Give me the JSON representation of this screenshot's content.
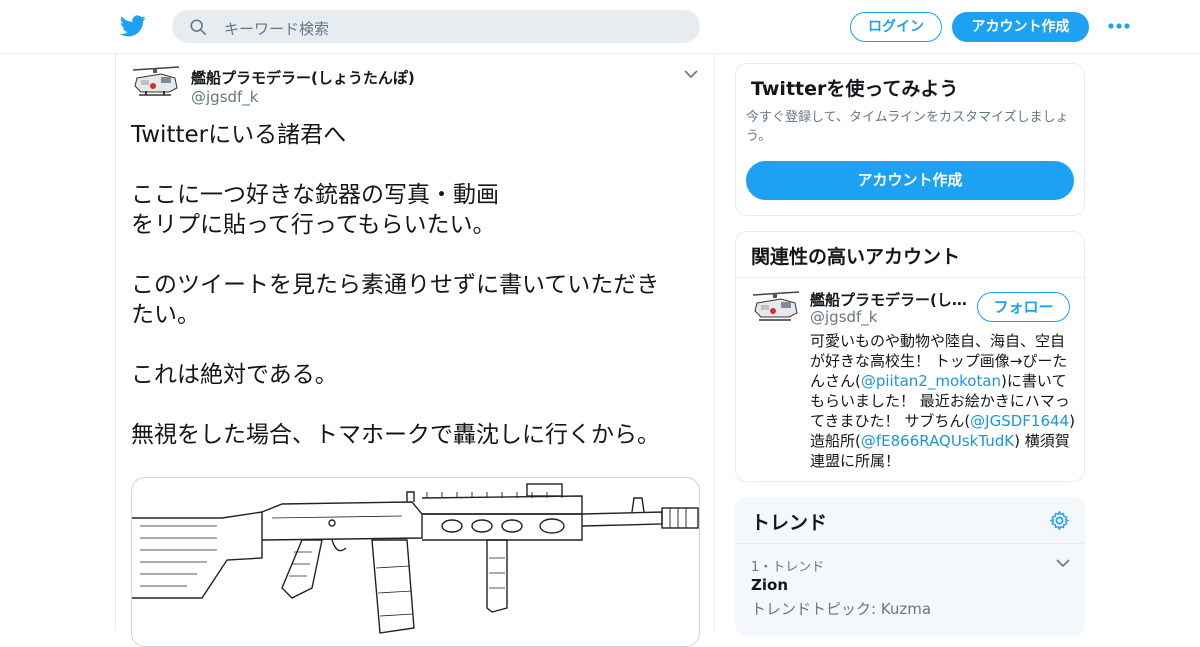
{
  "header": {
    "search_placeholder": "キーワード検索",
    "login_label": "ログイン",
    "signup_label": "アカウント作成",
    "brand_color": "#1da1f2"
  },
  "tweet": {
    "display_name": "艦船プラモデラー(しょうたんぽ)",
    "handle": "@jgsdf_k",
    "paragraphs": [
      "Twitterにいる諸君へ",
      "ここに一つ好きな銃器の写真・動画\nをリプに貼って行ってもらいたい。",
      "このツイートを見たら素通りせずに書いていただき\nたい。",
      "これは絶対である。",
      "無視をした場合、トマホークで轟沈しに行くから。"
    ]
  },
  "sidebar": {
    "signup_card": {
      "title": "Twitterを使ってみよう",
      "description": "今すぐ登録して、タイムラインをカスタマイズしましょう。",
      "button": "アカウント作成"
    },
    "related_card": {
      "title": "関連性の高いアカウント",
      "name": "艦船プラモデラー(しょうたんぽ)",
      "handle": "@jgsdf_k",
      "follow_label": "フォロー",
      "bio_parts": {
        "p1": "可愛いものや動物や陸自、海自、空自が好きな高校生！ トップ画像→ぴーたんさん(",
        "link1": "@piitan2_mokotan",
        "p2": ")に書いてもらいました！ 最近お絵かきにハマってきまひた！ サブちん(",
        "link2": "@JGSDF1644",
        "p3": ") 造船所(",
        "link3": "@fE866RAQUskTudK",
        "p4": ") 横須賀連盟に所属！"
      }
    },
    "trends_card": {
      "title": "トレンド",
      "items": [
        {
          "meta": "1・トレンド",
          "name": "Zion",
          "topic": "トレンドトピック: Kuzma"
        }
      ]
    }
  }
}
